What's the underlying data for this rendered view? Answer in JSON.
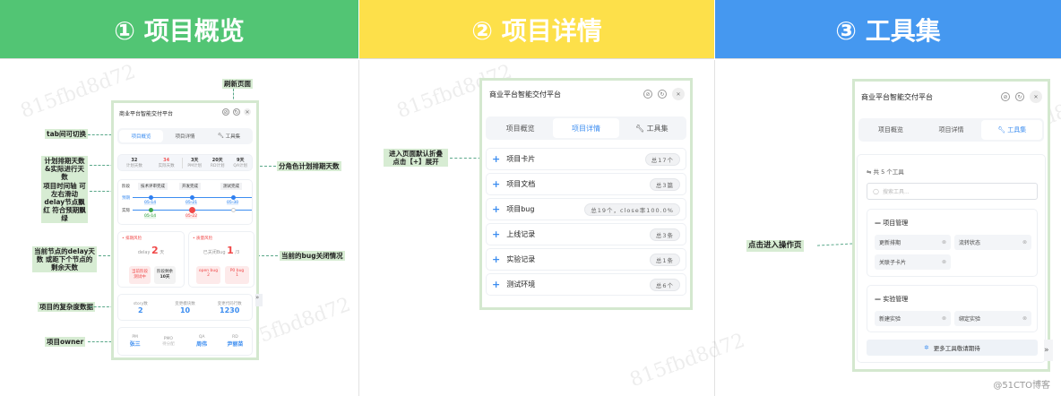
{
  "headers": [
    {
      "label": "① 项目概览",
      "color": "#52c574"
    },
    {
      "label": "② 项目详情",
      "color": "#fde04a"
    },
    {
      "label": "③ 工具集",
      "color": "#4598f0"
    }
  ],
  "app_title": "商业平台智能交付平台",
  "tabs": [
    "项目概览",
    "项目详情",
    "工具集"
  ],
  "watermark": "815fbd8d72",
  "credit": "@51CTO博客",
  "overview": {
    "annotations": {
      "refresh": "刷新页面",
      "tabs": "tab间可切换",
      "days": "计划排期天数&实际进行天数",
      "timeline": "项目时间轴 可左右滑动 delay节点飘红 符合预期飘绿",
      "delay": "当前节点的delay天数 或距下个节点的剩余天数",
      "role_days": "分角色计划排期天数",
      "bug": "当前的bug关闭情况",
      "complexity": "项目的复杂度数据",
      "owner": "项目owner"
    },
    "stats": [
      {
        "value": "32",
        "label": "计划天数"
      },
      {
        "value": "34",
        "label": "实际天数"
      },
      {
        "value": "3天",
        "label": "PM计划"
      },
      {
        "value": "20天",
        "label": "RD计划"
      },
      {
        "value": "9天",
        "label": "QA计划"
      }
    ],
    "timeline": {
      "stage_label": "阶段",
      "plan_label": "预期",
      "actual_label": "实际",
      "stages": [
        "技术评审完成",
        "开发完成",
        "测试完成"
      ],
      "plan": [
        "05-14",
        "05-21",
        "05-30"
      ],
      "actual": [
        "05-14",
        "05-22"
      ]
    },
    "schedule_risk": {
      "title": "• 排期风险",
      "label": "delay",
      "value": "2",
      "unit": "天",
      "tags": [
        {
          "l1": "当前阶段",
          "l2": "测试中"
        },
        {
          "l1": "阶段剩余",
          "l2": "10天"
        }
      ]
    },
    "quality_risk": {
      "title": "• 质量风险",
      "label": "已关闭Bug",
      "value": "1",
      "unit": "/3",
      "tags": [
        {
          "l1": "open bug",
          "l2": "2"
        },
        {
          "l1": "P0 bug",
          "l2": "1"
        }
      ]
    },
    "complexity": [
      {
        "label": "story数",
        "value": "2"
      },
      {
        "label": "变更模块数",
        "value": "10"
      },
      {
        "label": "变更代码行数",
        "value": "1230"
      }
    ],
    "owners": [
      {
        "role": "PM",
        "name": "张三"
      },
      {
        "role": "PMO",
        "name": "待分配"
      },
      {
        "role": "QA",
        "name": "周伟"
      },
      {
        "role": "RD",
        "name": "尹丽苗"
      }
    ]
  },
  "details": {
    "annotation": "进入页面默认折叠 点击【+】展开",
    "rows": [
      {
        "label": "项目卡片",
        "count": "总17个"
      },
      {
        "label": "项目文档",
        "count": "总3篇"
      },
      {
        "label": "项目bug",
        "count": "总19个，close率100.0%"
      },
      {
        "label": "上线记录",
        "count": "总3条"
      },
      {
        "label": "实验记录",
        "count": "总1条"
      },
      {
        "label": "测试环境",
        "count": "总6个"
      }
    ]
  },
  "tools": {
    "annotation": "点击进入操作页",
    "count": "共 5 个工具",
    "search_placeholder": "搜索工具...",
    "groups": [
      {
        "title": "项目管理",
        "items": [
          "更新排期",
          "流转状态",
          "关联子卡片"
        ]
      },
      {
        "title": "实验管理",
        "items": [
          "新建实验",
          "绑定实验"
        ]
      }
    ],
    "more": "更多工具敬请期待"
  }
}
